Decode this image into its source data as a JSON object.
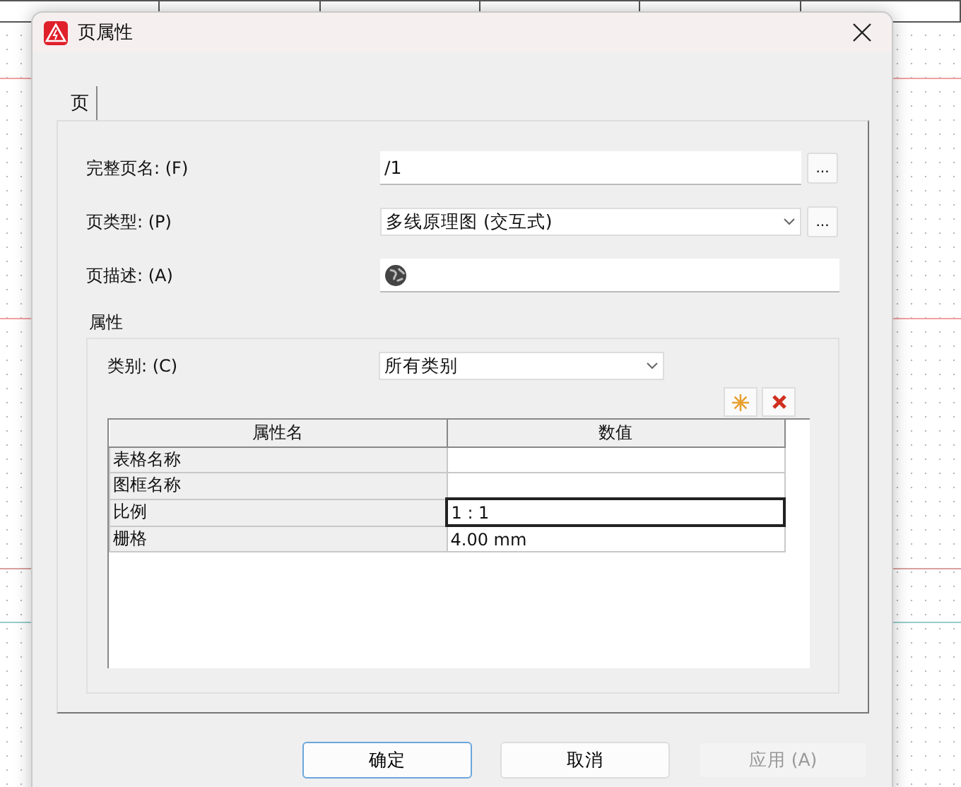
{
  "window": {
    "title": "页属性"
  },
  "tabs": [
    {
      "label": "页",
      "selected": true
    }
  ],
  "fields": [
    {
      "kind": "text",
      "label": "完整页名: (F)",
      "value": "/1",
      "button": "..."
    },
    {
      "kind": "combo",
      "label": "页类型: (P)",
      "value": "多线原理图 (交互式)",
      "button": "..."
    },
    {
      "kind": "globe",
      "label": "页描述: (A)"
    }
  ],
  "properties": {
    "title": "属性",
    "category": {
      "label": "类别: (C)",
      "value": "所有类别"
    },
    "table": {
      "columns": [
        "属性名",
        "数值"
      ],
      "rows": [
        {
          "name": "表格名称",
          "value": "",
          "selected": false
        },
        {
          "name": "图框名称",
          "value": "",
          "selected": false
        },
        {
          "name": "比例",
          "value": "1 : 1",
          "selected": true
        },
        {
          "name": "栅格",
          "value": "4.00 mm",
          "selected": false
        }
      ]
    }
  },
  "buttons": [
    {
      "label": "确定",
      "default": true,
      "disabled": false
    },
    {
      "label": "取消",
      "default": false,
      "disabled": false
    },
    {
      "label": "应用 (A)",
      "default": false,
      "disabled": true
    }
  ]
}
